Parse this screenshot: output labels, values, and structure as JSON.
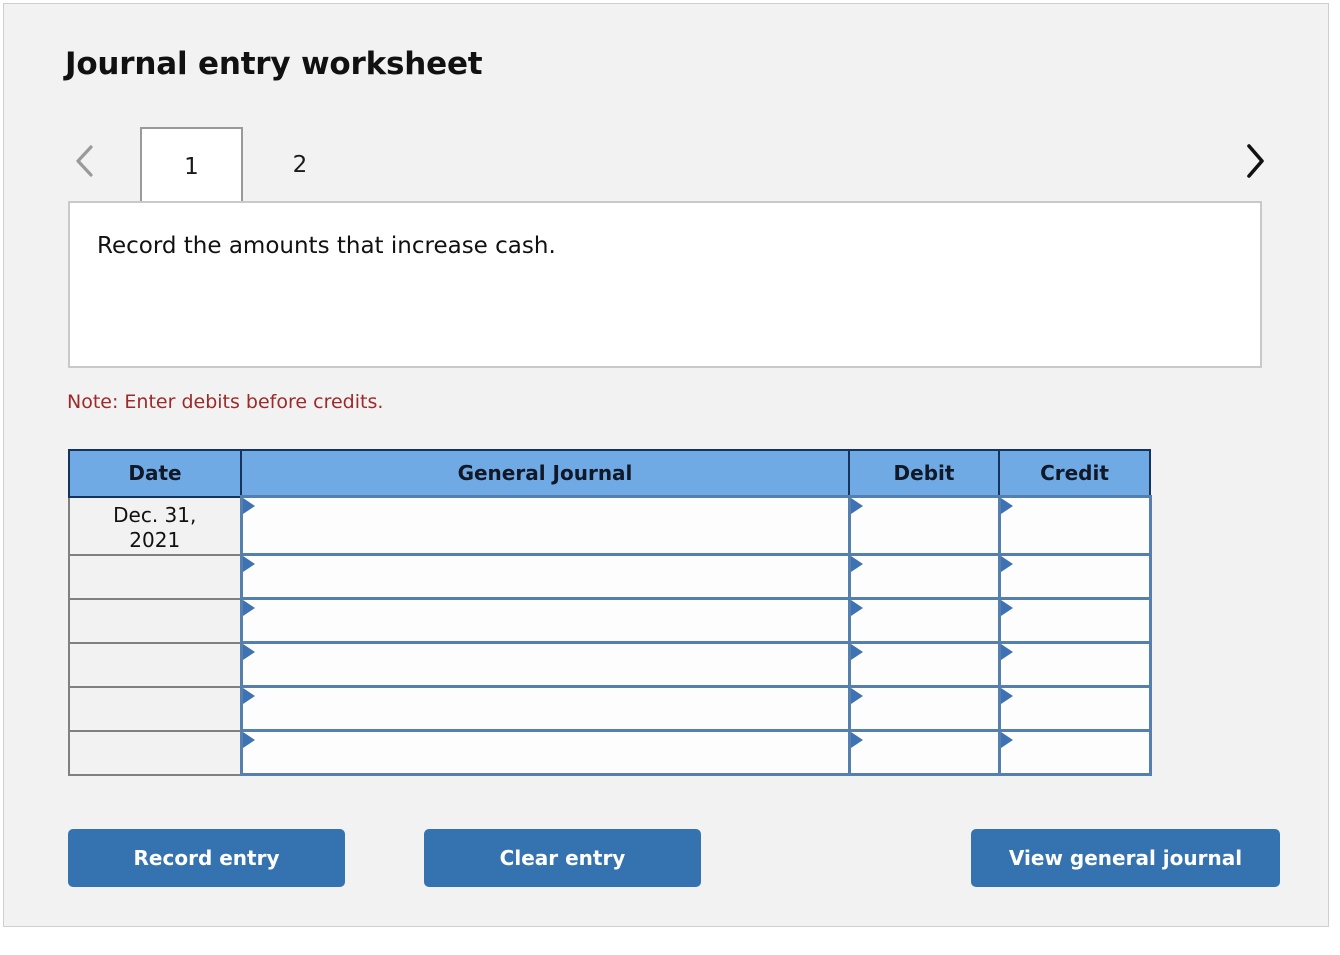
{
  "page": {
    "title": "Journal entry worksheet"
  },
  "tabs": {
    "prev_icon": "chevron-left-icon",
    "next_icon": "chevron-right-icon",
    "items": [
      {
        "label": "1",
        "active": true
      },
      {
        "label": "2",
        "active": false
      }
    ]
  },
  "instruction": {
    "text": "Record the amounts that increase cash."
  },
  "note": {
    "text": "Note: Enter debits before credits."
  },
  "table": {
    "headers": {
      "date": "Date",
      "general_journal": "General Journal",
      "debit": "Debit",
      "credit": "Credit"
    },
    "rows": [
      {
        "date_line1": "Dec. 31,",
        "date_line2": "2021",
        "general_journal": "",
        "debit": "",
        "credit": ""
      },
      {
        "date_line1": "",
        "date_line2": "",
        "general_journal": "",
        "debit": "",
        "credit": ""
      },
      {
        "date_line1": "",
        "date_line2": "",
        "general_journal": "",
        "debit": "",
        "credit": ""
      },
      {
        "date_line1": "",
        "date_line2": "",
        "general_journal": "",
        "debit": "",
        "credit": ""
      },
      {
        "date_line1": "",
        "date_line2": "",
        "general_journal": "",
        "debit": "",
        "credit": ""
      },
      {
        "date_line1": "",
        "date_line2": "",
        "general_journal": "",
        "debit": "",
        "credit": ""
      }
    ]
  },
  "buttons": {
    "record": "Record entry",
    "clear": "Clear entry",
    "view": "View general journal"
  },
  "colors": {
    "header_blue": "#6faae5",
    "button_blue": "#3572b0",
    "note_red": "#9c2a2a",
    "cell_border_blue": "#5580ae",
    "marker_blue": "#3f72b4",
    "panel_bg": "#f2f2f2"
  }
}
